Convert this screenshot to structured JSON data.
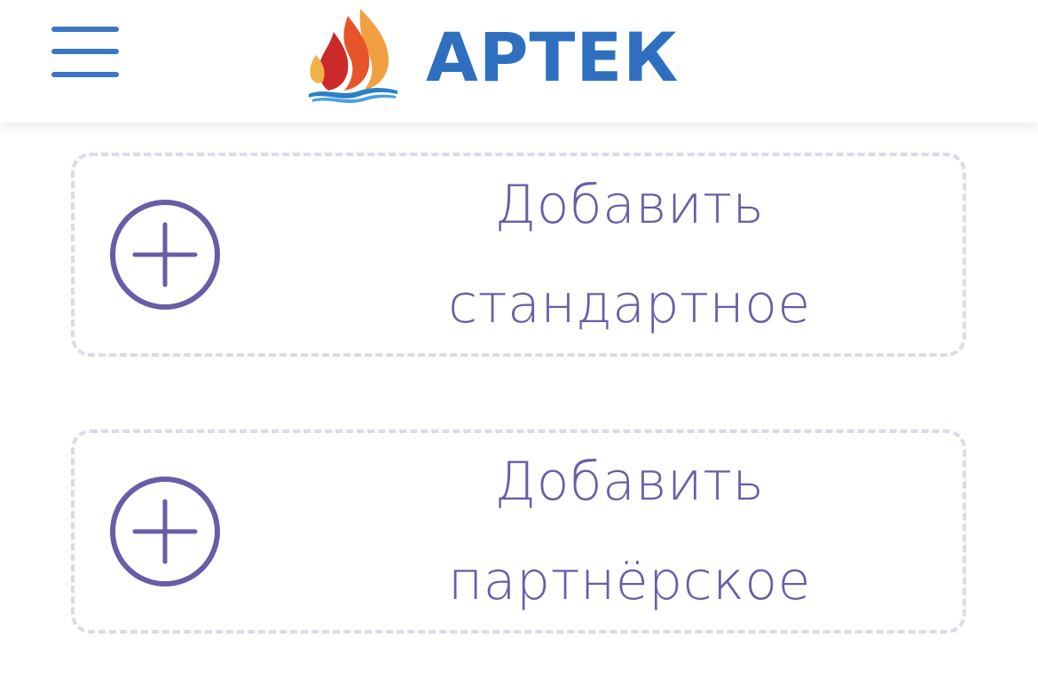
{
  "header": {
    "logo_text": "АРТЕК",
    "menu_icon": "hamburger-menu-icon",
    "logo_icon": "flame-logo-icon",
    "colors": {
      "brand_blue": "#2f6fc0",
      "menu_blue": "#3a78c2"
    }
  },
  "cards": [
    {
      "line1": "Добавить",
      "line2": "стандартное",
      "icon": "plus-circle-icon"
    },
    {
      "line1": "Добавить",
      "line2": "партнёрское",
      "icon": "plus-circle-icon"
    }
  ],
  "colors": {
    "accent_purple": "#6a5ca6",
    "dashed_border": "#dcdaea"
  }
}
